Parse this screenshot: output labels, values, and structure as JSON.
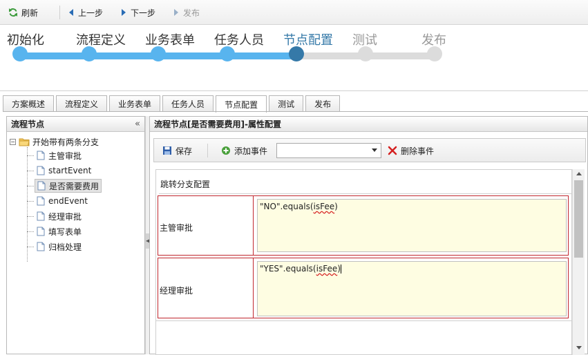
{
  "toolbar": {
    "refresh": "刷新",
    "prev": "上一步",
    "next": "下一步",
    "publish": "发布"
  },
  "steps": [
    {
      "label": "初始化",
      "state": "done"
    },
    {
      "label": "流程定义",
      "state": "done"
    },
    {
      "label": "业务表单",
      "state": "done"
    },
    {
      "label": "任务人员",
      "state": "done"
    },
    {
      "label": "节点配置",
      "state": "current"
    },
    {
      "label": "测试",
      "state": "pending"
    },
    {
      "label": "发布",
      "state": "pending"
    }
  ],
  "colors": {
    "done": "#58b4ee",
    "current": "#3579a8",
    "pending": "#dcdcdc",
    "current_label": "#3579a8",
    "pending_label": "#999999",
    "condition_border": "#c0262d"
  },
  "tabs": [
    "方案概述",
    "流程定义",
    "业务表单",
    "任务人员",
    "节点配置",
    "测试",
    "发布"
  ],
  "active_tab": "节点配置",
  "left_panel": {
    "title": "流程节点",
    "root": "开始带有两条分支",
    "items": [
      "主管审批",
      "startEvent",
      "是否需要费用",
      "endEvent",
      "经理审批",
      "填写表单",
      "归档处理"
    ],
    "selected": "是否需要费用"
  },
  "right_panel": {
    "title": "流程节点[是否需要费用]-属性配置",
    "save": "保存",
    "add_event": "添加事件",
    "select_value": "",
    "delete_event": "删除事件",
    "section_title": "跳转分支配置",
    "conditions": [
      {
        "label": "主管审批",
        "prefix": "\"NO\".equals(",
        "var": "isFee",
        "suffix": ")"
      },
      {
        "label": "经理审批",
        "prefix": "\"YES\".equals(",
        "var": "isFee",
        "suffix": ")"
      }
    ]
  }
}
